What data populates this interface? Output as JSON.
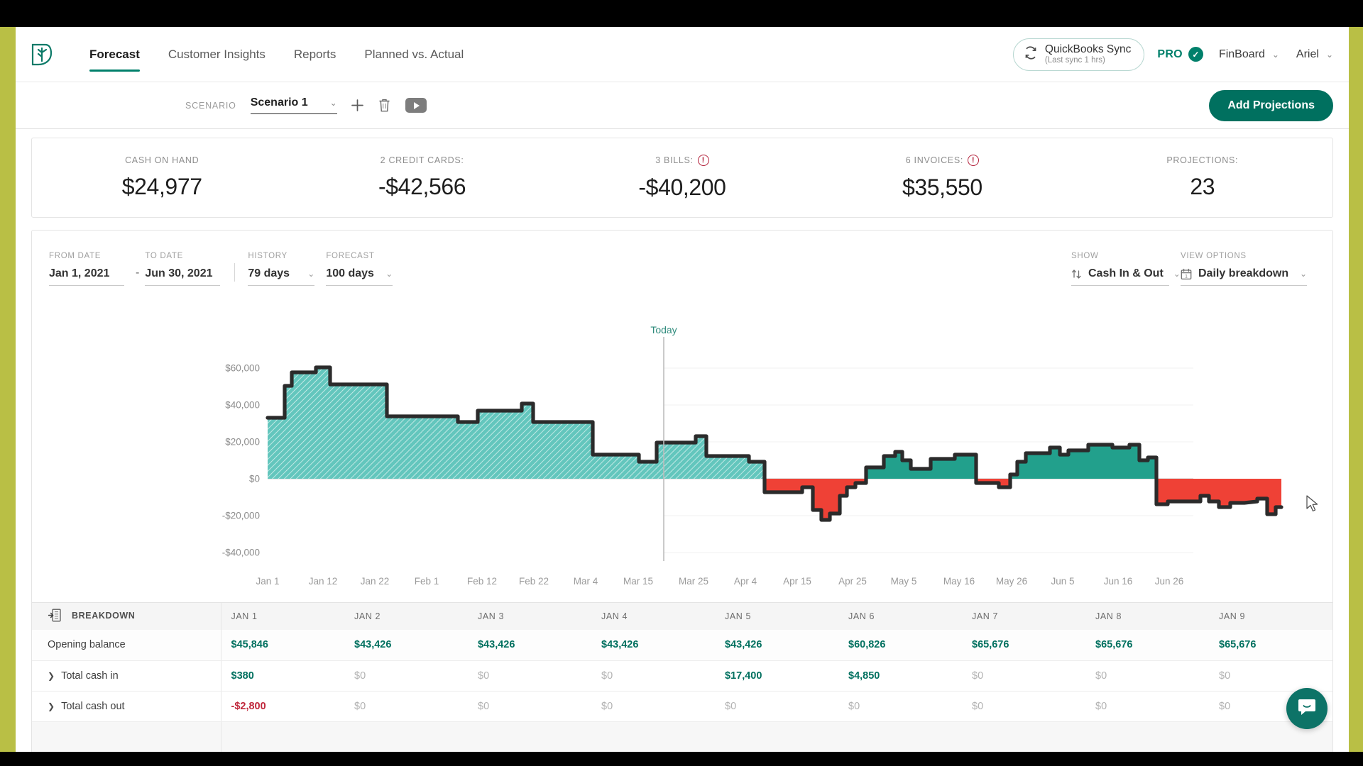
{
  "app": {
    "logo_icon": "leaf-logo-icon",
    "accent": "#00705f",
    "negative_color": "#c0283c",
    "positive_color": "#00705f"
  },
  "topnav": {
    "links": [
      {
        "label": "Forecast",
        "active": true
      },
      {
        "label": "Customer Insights",
        "active": false
      },
      {
        "label": "Reports",
        "active": false
      },
      {
        "label": "Planned vs. Actual",
        "active": false
      }
    ],
    "quickbooks": {
      "title": "QuickBooks Sync",
      "subtitle": "(Last sync 1 hrs)",
      "icon": "sync-icon"
    },
    "plan_badge": {
      "label": "PRO",
      "icon": "check-circle-icon"
    },
    "company": {
      "label": "FinBoard",
      "icon": "chevron-down-icon"
    },
    "user": {
      "label": "Ariel",
      "icon": "chevron-down-icon"
    }
  },
  "scenario_bar": {
    "label": "SCENARIO",
    "selected": "Scenario 1",
    "add_icon": "plus-icon",
    "delete_icon": "trash-icon",
    "play_icon": "play-icon",
    "add_projections_label": "Add Projections"
  },
  "kpis": [
    {
      "label": "CASH ON HAND",
      "value": "$24,977",
      "warning": false
    },
    {
      "label": "2 CREDIT CARDS:",
      "value": "-$42,566",
      "warning": false
    },
    {
      "label": "3 BILLS:",
      "value": "-$40,200",
      "warning": true
    },
    {
      "label": "6 INVOICES:",
      "value": "$35,550",
      "warning": true
    },
    {
      "label": "PROJECTIONS:",
      "value": "23",
      "warning": false
    }
  ],
  "filters": {
    "from_date": {
      "label": "FROM DATE",
      "value": "Jan 1, 2021"
    },
    "separator": "-",
    "to_date": {
      "label": "TO DATE",
      "value": "Jun 30, 2021"
    },
    "history": {
      "label": "HISTORY",
      "value": "79 days",
      "icon": "chevron-down-icon"
    },
    "forecast": {
      "label": "FORECAST",
      "value": "100 days",
      "icon": "chevron-down-icon"
    },
    "show": {
      "label": "SHOW",
      "value": "Cash In & Out",
      "icon": "arrows-up-down-icon",
      "caret": "chevron-down-icon"
    },
    "view_options": {
      "label": "VIEW OPTIONS",
      "value": "Daily breakdown",
      "icon": "calendar-icon",
      "caret": "chevron-down-icon"
    }
  },
  "chart_data": {
    "type": "area",
    "title": "",
    "xlabel": "",
    "ylabel": "",
    "ylim": [
      -48000,
      72000
    ],
    "grid": true,
    "legend": null,
    "annotations": [
      {
        "text": "Today",
        "x": "Mar 22",
        "color": "#2f8b7c"
      }
    ],
    "ytick_labels": [
      "$60,000",
      "$40,000",
      "$20,000",
      "$0",
      "-$20,000",
      "-$40,000"
    ],
    "ytick_values": [
      60000,
      40000,
      20000,
      0,
      -20000,
      -40000
    ],
    "xtick_labels": [
      "Jan 1",
      "Jan 12",
      "Jan 22",
      "Feb 1",
      "Feb 12",
      "Feb 22",
      "Mar 4",
      "Mar 15",
      "Mar 25",
      "Apr 4",
      "Apr 15",
      "Apr 25",
      "May 5",
      "May 16",
      "May 26",
      "Jun 5",
      "Jun 16",
      "Jun 26"
    ],
    "series": [
      {
        "name": "Historical cash balance",
        "style": "hatched-teal",
        "fill": "#63c6bd",
        "values": [
          45846,
          43426,
          43426,
          43426,
          43426,
          60826,
          65676,
          65676,
          65676,
          65676,
          65676,
          68500,
          68500,
          56800,
          56800,
          56800,
          56800,
          56800,
          56800,
          56800,
          56800,
          56800,
          42000,
          42000,
          42000,
          42000,
          38600,
          38600,
          38600,
          45500,
          45500,
          45500,
          49500,
          49500,
          38600,
          38600,
          38600,
          38600,
          25500,
          25500,
          25500,
          25500,
          23000,
          23000,
          23000,
          30500,
          30500,
          30500,
          33500,
          27000,
          27000,
          27000,
          27000,
          27000,
          26000
        ]
      },
      {
        "name": "Projected cash balance (positive)",
        "style": "solid-teal",
        "fill": "#1f9e8a"
      },
      {
        "name": "Projected cash balance (negative)",
        "style": "solid-red",
        "fill": "#ef4136"
      }
    ],
    "forecast_values": [
      -6000,
      -7500,
      -7500,
      -7500,
      -7500,
      -18500,
      -22500,
      -19000,
      -4500,
      -2000,
      -1200,
      5200,
      5200,
      8500,
      10500,
      5500,
      2500,
      2500,
      7000,
      8000,
      8000,
      8000,
      -2500,
      -2500,
      -3500,
      -5500,
      800,
      9500,
      15500,
      15500,
      13500,
      18000,
      18000,
      16500,
      11500,
      13500,
      16000,
      16000,
      16500,
      16500,
      18000,
      5000,
      6500,
      -19500,
      -14500,
      -14000,
      -14000,
      -11500,
      -16000,
      -13500,
      -13500,
      -13000,
      -13000,
      -13500,
      -26500,
      -14500
    ]
  },
  "breakdown_table": {
    "icon": "export-table-icon",
    "first_column_header": "BREAKDOWN",
    "columns": [
      "JAN 1",
      "JAN 2",
      "JAN 3",
      "JAN 4",
      "JAN 5",
      "JAN 6",
      "JAN 7",
      "JAN 8",
      "JAN 9"
    ],
    "rows": [
      {
        "label": "Opening balance",
        "expandable": false,
        "cells": [
          {
            "text": "$45,846",
            "tone": "pos"
          },
          {
            "text": "$43,426",
            "tone": "pos"
          },
          {
            "text": "$43,426",
            "tone": "pos"
          },
          {
            "text": "$43,426",
            "tone": "pos"
          },
          {
            "text": "$43,426",
            "tone": "pos"
          },
          {
            "text": "$60,826",
            "tone": "pos"
          },
          {
            "text": "$65,676",
            "tone": "pos"
          },
          {
            "text": "$65,676",
            "tone": "pos"
          },
          {
            "text": "$65,676",
            "tone": "pos"
          }
        ]
      },
      {
        "label": "Total cash in",
        "expandable": true,
        "cells": [
          {
            "text": "$380",
            "tone": "pos"
          },
          {
            "text": "$0",
            "tone": "zero"
          },
          {
            "text": "$0",
            "tone": "zero"
          },
          {
            "text": "$0",
            "tone": "zero"
          },
          {
            "text": "$17,400",
            "tone": "pos"
          },
          {
            "text": "$4,850",
            "tone": "pos"
          },
          {
            "text": "$0",
            "tone": "zero"
          },
          {
            "text": "$0",
            "tone": "zero"
          },
          {
            "text": "$0",
            "tone": "zero"
          }
        ]
      },
      {
        "label": "Total cash out",
        "expandable": true,
        "cells": [
          {
            "text": "-$2,800",
            "tone": "neg"
          },
          {
            "text": "$0",
            "tone": "zero"
          },
          {
            "text": "$0",
            "tone": "zero"
          },
          {
            "text": "$0",
            "tone": "zero"
          },
          {
            "text": "$0",
            "tone": "zero"
          },
          {
            "text": "$0",
            "tone": "zero"
          },
          {
            "text": "$0",
            "tone": "zero"
          },
          {
            "text": "$0",
            "tone": "zero"
          },
          {
            "text": "$0",
            "tone": "zero"
          }
        ]
      }
    ]
  },
  "support": {
    "icon": "chat-bubble-icon"
  }
}
